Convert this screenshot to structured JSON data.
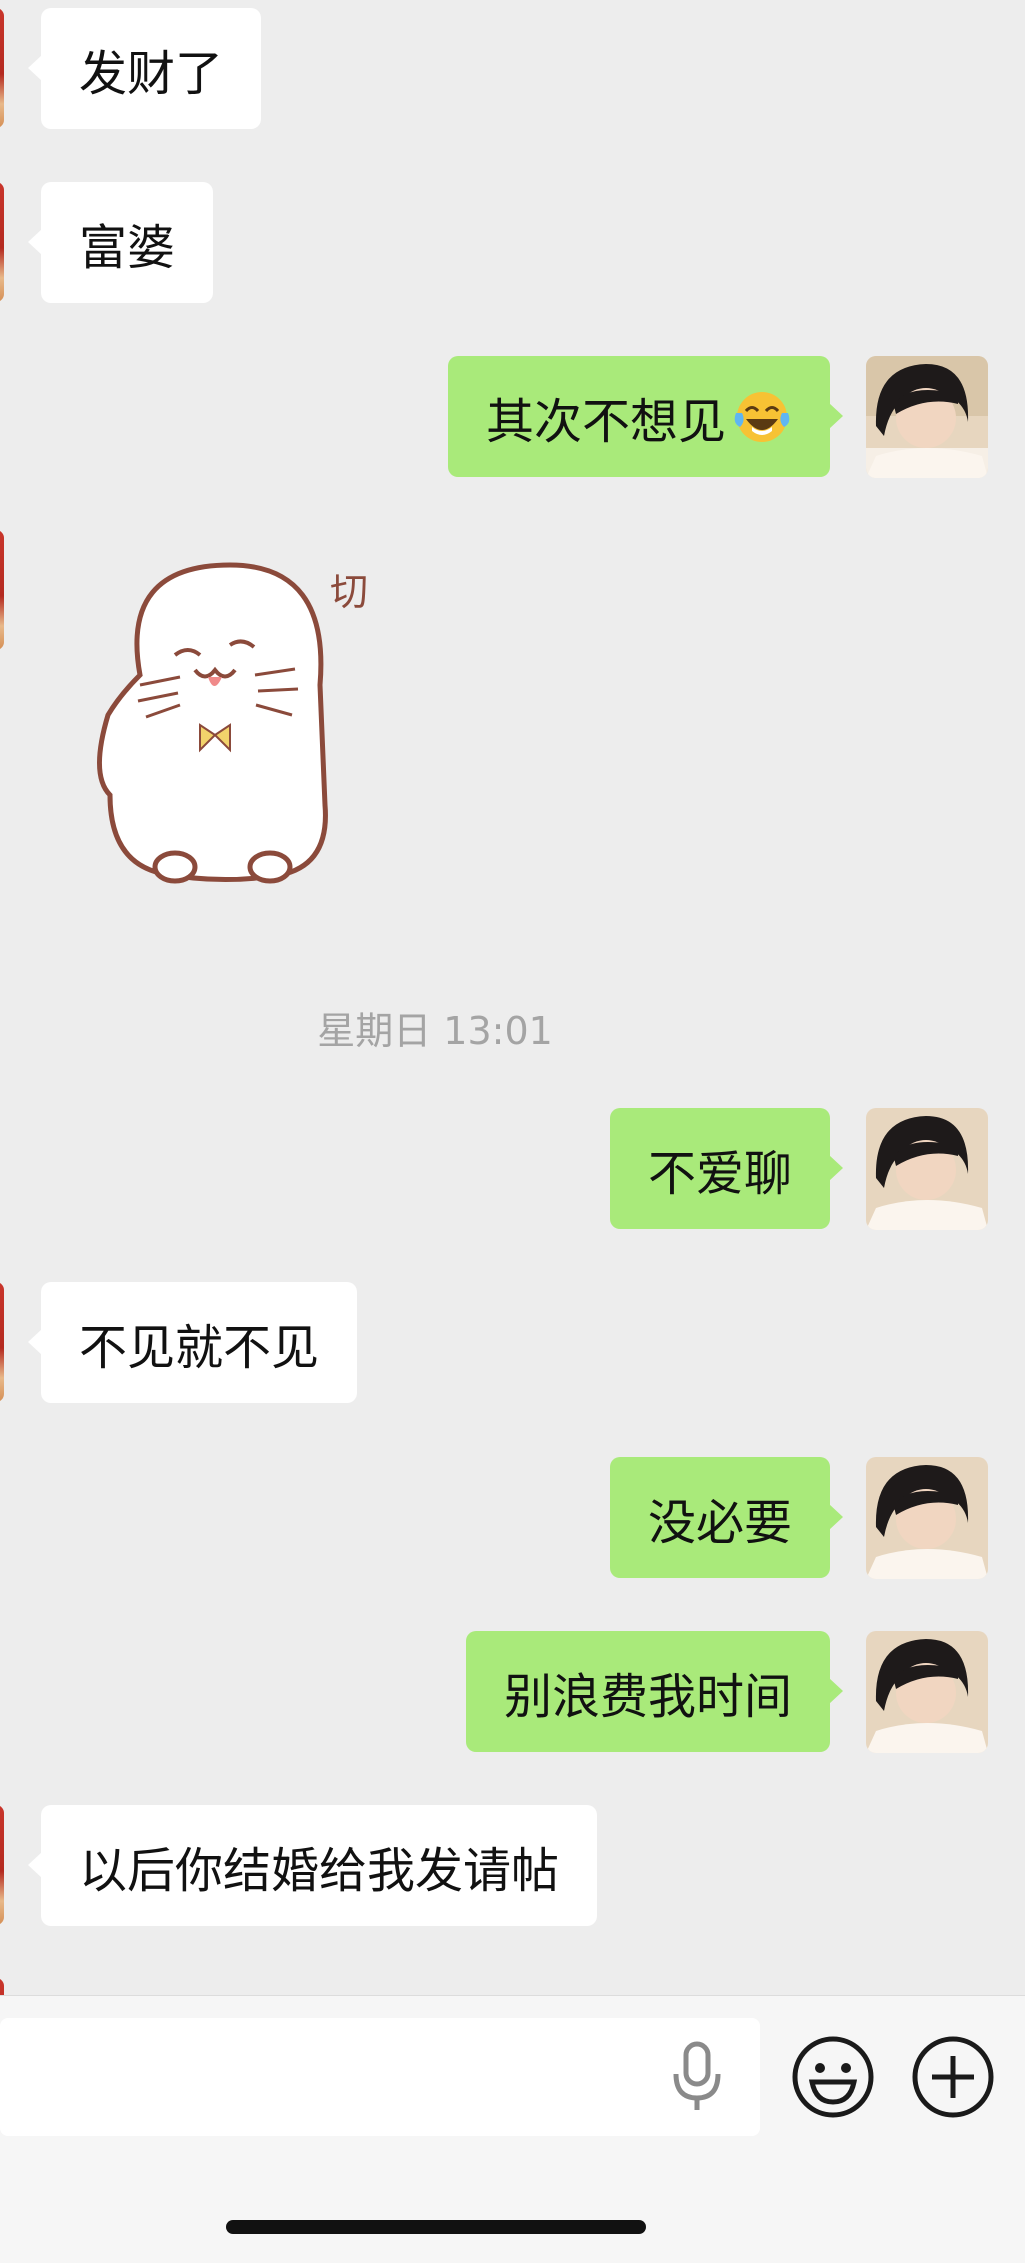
{
  "messages": {
    "m1": "发财了",
    "m2": "富婆",
    "m3": "其次不想见",
    "m3_emoji": "face-with-tears-of-joy-icon",
    "m4_sticker": "切",
    "timestamp": "星期日 13:01",
    "m5": "不爱聊",
    "m6": "不见就不见",
    "m7": "没必要",
    "m8": "别浪费我时间",
    "m9": "以后你结婚给我发请帖"
  },
  "input_bar": {
    "placeholder": "",
    "icons": [
      "microphone-icon",
      "emoji-icon",
      "plus-icon"
    ]
  },
  "colors": {
    "background": "#ededed",
    "outgoing_bubble": "#a9ea7a",
    "incoming_bubble": "#ffffff"
  }
}
